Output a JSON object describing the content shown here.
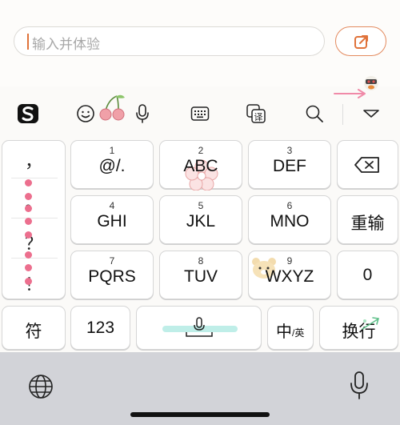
{
  "input": {
    "placeholder": "输入并体验"
  },
  "toolbar": {
    "icons": [
      "sogou-logo-icon",
      "emoji-icon",
      "cherry-decoration-icon",
      "microphone-icon",
      "keyboard-icon",
      "translate-icon",
      "search-icon",
      "collapse-icon"
    ]
  },
  "punctuation": [
    "，",
    "。",
    "？",
    "！"
  ],
  "keys": {
    "k1": {
      "num": "1",
      "label": "@/."
    },
    "k2": {
      "num": "2",
      "label": "ABC"
    },
    "k3": {
      "num": "3",
      "label": "DEF"
    },
    "k4": {
      "num": "4",
      "label": "GHI"
    },
    "k5": {
      "num": "5",
      "label": "JKL"
    },
    "k6": {
      "num": "6",
      "label": "MNO"
    },
    "k7": {
      "num": "7",
      "label": "PQRS"
    },
    "k8": {
      "num": "8",
      "label": "TUV"
    },
    "k9": {
      "num": "9",
      "label": "WXYZ"
    },
    "retype": "重输",
    "zero": "0",
    "symbols": "符",
    "num123": "123",
    "lang_main": "中",
    "lang_sub": "/英",
    "enter": "换行"
  },
  "colors": {
    "accent": "#e38a5e",
    "dots": "#ec6f8e",
    "bottom_bar": "#d2d3d8"
  }
}
